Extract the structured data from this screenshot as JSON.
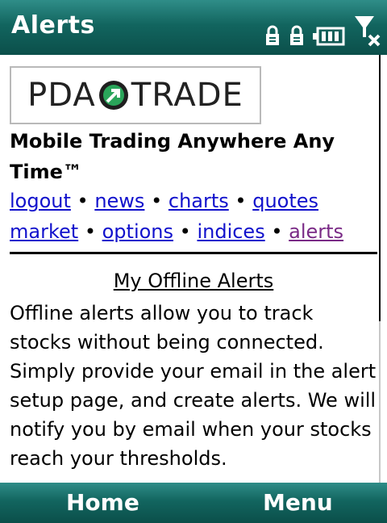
{
  "titlebar": {
    "title": "Alerts",
    "icons": [
      "lock-icon",
      "lock-icon",
      "battery-icon",
      "signal-off-icon"
    ]
  },
  "logo": {
    "left_text": "PDA",
    "right_text": "TRADE",
    "arrow_color": "#2aa55a"
  },
  "tagline": "Mobile Trading Anywhere Any Time™",
  "nav": {
    "links": [
      "logout",
      "news",
      "charts",
      "quotes",
      "market",
      "options",
      "indices",
      "alerts"
    ],
    "separator": "•"
  },
  "section": {
    "title": "My Offline Alerts",
    "description": "Offline alerts allow you to track stocks without being connected. Simply provide your email in the alert setup page, and create alerts. We will notify you by email when your stocks reach your thresholds."
  },
  "softkeys": {
    "left": "Home",
    "right": "Menu"
  },
  "colors": {
    "bar": "#12655f",
    "link": "#1111cc",
    "visited_link": "#7a2a86"
  }
}
